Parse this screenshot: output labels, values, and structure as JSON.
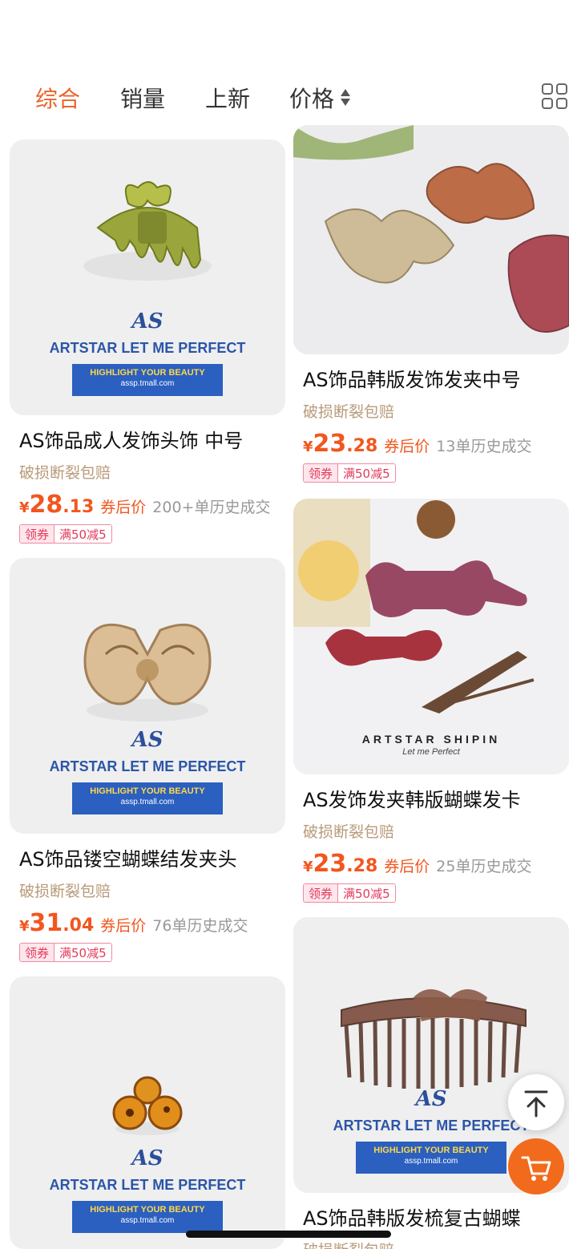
{
  "sort_tabs": [
    {
      "label": "综合",
      "active": true
    },
    {
      "label": "销量",
      "active": false
    },
    {
      "label": "上新",
      "active": false
    },
    {
      "label": "价格",
      "active": false
    }
  ],
  "icons": {
    "grid_toggle": "grid-view-icon",
    "sort": "sort-updown-icon",
    "back_to_top": "back-to-top-icon",
    "cart": "cart-icon"
  },
  "colors": {
    "accent": "#e8642c",
    "price": "#f2561e",
    "guarantee": "#b89a78",
    "coupon": "#e23a5b",
    "brand_blue": "#2b5fc0",
    "cart_button": "#f26a1b"
  },
  "brand_watermark": {
    "logo": "AS",
    "line": "ARTSTAR LET ME PERFECT",
    "slogan": "HIGHLIGHT YOUR BEAUTY",
    "site": "assp.tmall.com",
    "alt_line": "ARTSTAR SHIPIN",
    "alt_sub": "Let me Perfect"
  },
  "products": [
    {
      "title": "AS饰品成人发饰头饰 中号",
      "guarantee": "破损断裂包赔",
      "currency": "¥",
      "price_int": "28",
      "price_dec": ".13",
      "price_label": "券后价",
      "sold": "200+单历史成交",
      "coupon_label": "领券",
      "coupon_value": "满50减5"
    },
    {
      "title": "AS饰品韩版发饰发夹中号",
      "guarantee": "破损断裂包赔",
      "currency": "¥",
      "price_int": "23",
      "price_dec": ".28",
      "price_label": "券后价",
      "sold": "13单历史成交",
      "coupon_label": "领券",
      "coupon_value": "满50减5"
    },
    {
      "title": "AS饰品镂空蝴蝶结发夹头",
      "guarantee": "破损断裂包赔",
      "currency": "¥",
      "price_int": "31",
      "price_dec": ".04",
      "price_label": "券后价",
      "sold": "76单历史成交",
      "coupon_label": "领券",
      "coupon_value": "满50减5"
    },
    {
      "title": "AS发饰发夹韩版蝴蝶发卡",
      "guarantee": "破损断裂包赔",
      "currency": "¥",
      "price_int": "23",
      "price_dec": ".28",
      "price_label": "券后价",
      "sold": "25单历史成交",
      "coupon_label": "领券",
      "coupon_value": "满50减5"
    },
    {
      "title": "AS饰品韩版发梳复古蝴蝶",
      "guarantee": "破损断裂包赔"
    }
  ]
}
